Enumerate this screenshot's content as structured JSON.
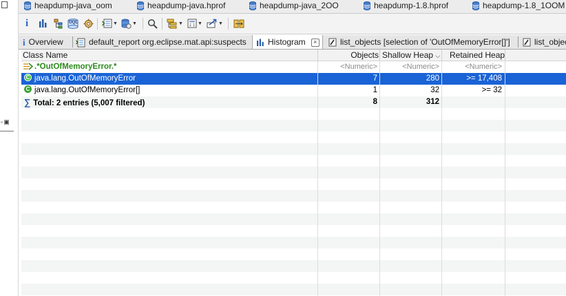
{
  "file_tabs": [
    {
      "label": "heapdump-java_oom"
    },
    {
      "label": "heapdump-java.hprof"
    },
    {
      "label": "heapdump-java_2OO"
    },
    {
      "label": "heapdump-1.8.hprof"
    },
    {
      "label": "heapdump-1.8_1OOM"
    }
  ],
  "view_tabs": {
    "overview": "Overview",
    "default_report": "default_report  org.eclipse.mat.api:suspects",
    "histogram": "Histogram",
    "list_objects_1": "list_objects  [selection of 'OutOfMemoryError[]']",
    "list_objects_2": "list_objects"
  },
  "toolbar": {
    "info_glyph": "i",
    "oql_label": "OQL"
  },
  "table": {
    "columns": {
      "class_name": "Class Name",
      "objects": "Objects",
      "shallow_heap": "Shallow Heap",
      "retained_heap": "Retained Heap"
    },
    "filter_row": {
      "class_name": ".*OutOfMemoryError.*",
      "objects": "<Numeric>",
      "shallow_heap": "<Numeric>",
      "retained_heap": "<Numeric>"
    },
    "rows": [
      {
        "class_name": "java.lang.OutOfMemoryError",
        "objects": "7",
        "shallow_heap": "280",
        "retained_heap": ">= 17,408",
        "selected": true
      },
      {
        "class_name": "java.lang.OutOfMemoryError[]",
        "objects": "1",
        "shallow_heap": "32",
        "retained_heap": ">= 32",
        "selected": false
      }
    ],
    "total_row": {
      "class_name": "Total: 2 entries (5,007 filtered)",
      "objects": "8",
      "shallow_heap": "312",
      "retained_heap": ""
    }
  },
  "colors": {
    "selection": "#1a63d6",
    "class_icon": "#3aa335",
    "filter_text": "#2e8b1e"
  }
}
